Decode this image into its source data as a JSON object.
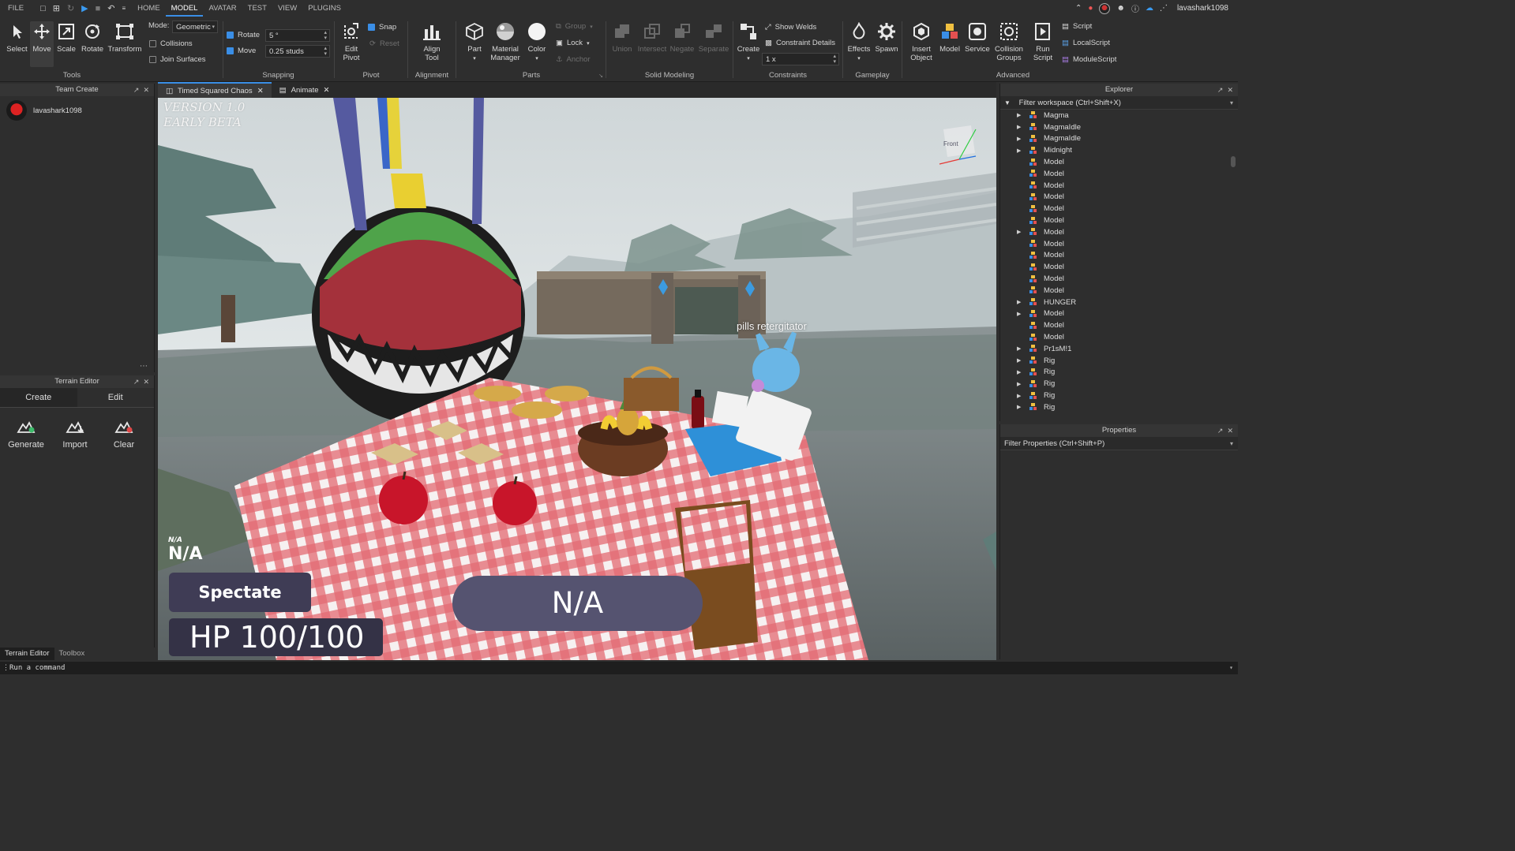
{
  "menubar": {
    "items": [
      "FILE",
      "HOME",
      "MODEL",
      "AVATAR",
      "TEST",
      "VIEW",
      "PLUGINS"
    ],
    "username": "lavashark1098"
  },
  "ribbon": {
    "tools": {
      "select": "Select",
      "move": "Move",
      "scale": "Scale",
      "rotate": "Rotate",
      "transform": "Transform",
      "title": "Tools"
    },
    "mode": {
      "label": "Mode:",
      "value": "Geometric",
      "collisions": "Collisions",
      "join_surfaces": "Join Surfaces"
    },
    "snapping": {
      "rotate": "Rotate",
      "rotate_value": "5 °",
      "move": "Move",
      "move_value": "0.25 studs",
      "title": "Snapping"
    },
    "pivot": {
      "edit_pivot_1": "Edit",
      "edit_pivot_2": "Pivot",
      "snap": "Snap",
      "reset": "Reset",
      "title": "Pivot"
    },
    "alignment": {
      "align_1": "Align",
      "align_2": "Tool",
      "title": "Alignment"
    },
    "parts": {
      "part": "Part",
      "material_1": "Material",
      "material_2": "Manager",
      "color": "Color",
      "group": "Group",
      "lock": "Lock",
      "anchor": "Anchor",
      "title": "Parts"
    },
    "solid_modeling": {
      "union": "Union",
      "intersect": "Intersect",
      "negate": "Negate",
      "separate": "Separate",
      "title": "Solid Modeling"
    },
    "constraints": {
      "create": "Create",
      "show_welds": "Show Welds",
      "constraint_details": "Constraint Details",
      "scale_value": "1 x",
      "title": "Constraints"
    },
    "gameplay": {
      "effects": "Effects",
      "spawn": "Spawn",
      "title": "Gameplay"
    },
    "advanced": {
      "insert_1": "Insert",
      "insert_2": "Object",
      "model": "Model",
      "service": "Service",
      "collision_1": "Collision",
      "collision_2": "Groups",
      "run_1": "Run",
      "run_2": "Script",
      "script": "Script",
      "local_script": "LocalScript",
      "module_script": "ModuleScript",
      "title": "Advanced"
    }
  },
  "team_create": {
    "title": "Team Create",
    "user": "lavashark1098"
  },
  "terrain_editor": {
    "title": "Terrain Editor",
    "tabs": [
      "Create",
      "Edit"
    ],
    "tools": [
      "Generate",
      "Import",
      "Clear"
    ]
  },
  "bottom_tabs": [
    "Terrain Editor",
    "Toolbox"
  ],
  "doc_tabs": [
    "Timed Squared Chaos",
    "Animate"
  ],
  "viewport": {
    "version_line1": "VERSION 1.0",
    "version_line2": "EARLY BETA",
    "view_cube": "Front",
    "billboard": "pills retergitator",
    "na_small": "N/A",
    "na_big": "N/A",
    "spectate": "Spectate",
    "hp": "HP 100/100",
    "timer": "N/A"
  },
  "explorer": {
    "title": "Explorer",
    "filter": "Filter workspace (Ctrl+Shift+X)",
    "items": [
      {
        "label": "Magma",
        "arrow": true
      },
      {
        "label": "MagmaIdle",
        "arrow": true
      },
      {
        "label": "MagmaIdle",
        "arrow": true
      },
      {
        "label": "Midnight",
        "arrow": true
      },
      {
        "label": "Model",
        "arrow": false
      },
      {
        "label": "Model",
        "arrow": false
      },
      {
        "label": "Model",
        "arrow": false
      },
      {
        "label": "Model",
        "arrow": false
      },
      {
        "label": "Model",
        "arrow": false
      },
      {
        "label": "Model",
        "arrow": false
      },
      {
        "label": "Model",
        "arrow": true
      },
      {
        "label": "Model",
        "arrow": false
      },
      {
        "label": "Model",
        "arrow": false
      },
      {
        "label": "Model",
        "arrow": false
      },
      {
        "label": "Model",
        "arrow": false
      },
      {
        "label": "Model",
        "arrow": false
      },
      {
        "label": "HUNGER",
        "arrow": true
      },
      {
        "label": "Model",
        "arrow": true
      },
      {
        "label": "Model",
        "arrow": false
      },
      {
        "label": "Model",
        "arrow": false
      },
      {
        "label": "Pr1sM!1",
        "arrow": true
      },
      {
        "label": "Rig",
        "arrow": true
      },
      {
        "label": "Rig",
        "arrow": true
      },
      {
        "label": "Rig",
        "arrow": true
      },
      {
        "label": "Rig",
        "arrow": true
      },
      {
        "label": "Rig",
        "arrow": true
      },
      {
        "label": "Rig",
        "arrow": true
      }
    ]
  },
  "properties": {
    "title": "Properties",
    "filter": "Filter Properties (Ctrl+Shift+P)"
  },
  "command_bar": {
    "placeholder": "Run a command"
  },
  "colors": {
    "accent": "#3a8ee6",
    "panel": "#2e2e2e",
    "hud_button": "#3f3c55",
    "hud_timer": "#555370"
  }
}
